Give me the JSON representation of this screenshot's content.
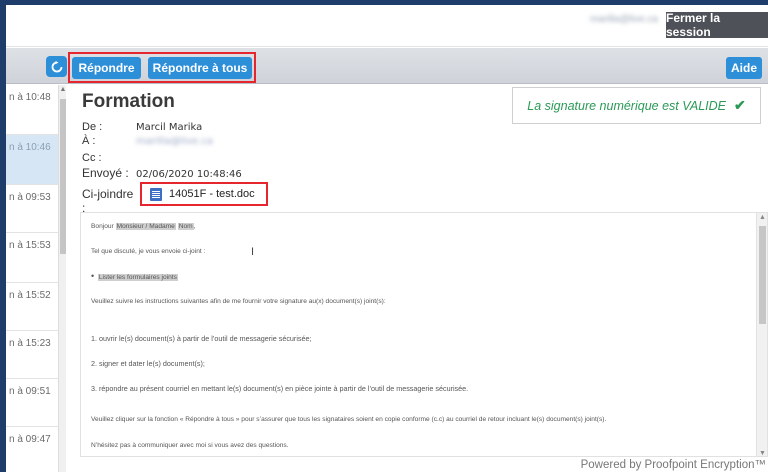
{
  "header": {
    "user_email": "marilla@live.ca",
    "logout_label": "Fermer la session"
  },
  "toolbar": {
    "reply_label": "Répondre",
    "reply_all_label": "Répondre à tous",
    "help_label": "Aide",
    "refresh_icon": "refresh-icon"
  },
  "message_list": {
    "items": [
      {
        "time": "n à 10:48"
      },
      {
        "time": "n à 10:46"
      },
      {
        "time": "n à 09:53"
      },
      {
        "time": "n à 15:53"
      },
      {
        "time": "n à 15:52"
      },
      {
        "time": "n à 15:23"
      },
      {
        "time": "n à 09:51"
      },
      {
        "time": "n à 09:47"
      }
    ]
  },
  "message": {
    "subject": "Formation",
    "from_label": "De :",
    "from_value": "Marcil Marika",
    "to_label": "À :",
    "to_value": "marilla@live.ca",
    "cc_label": "Cc :",
    "sent_label": "Envoyé :",
    "sent_value": "02/06/2020 10:48:46",
    "attach_label": "Ci-joindre :",
    "attachment_name": "14051F - test.doc"
  },
  "signature": {
    "text": "La signature numérique est VALIDE",
    "check": "✔",
    "color": "#2b9a57"
  },
  "body": {
    "greeting_prefix": "Bonjour",
    "greeting_placeholder": "Monsieur / Madame",
    "greeting_name": "Nom",
    "greeting_suffix": ",",
    "intro": "Tel que discuté, je vous envoie ci-joint :",
    "bullet": "Lister les formulaires joints",
    "instructions": "Veuillez suivre les instructions suivantes afin de me fournir votre signature au(x) document(s) joint(s):",
    "step1": "1.  ouvrir le(s) document(s) à partir de l’outil de messagerie sécurisée;",
    "step2": "2.  signer et dater le(s) document(s);",
    "step3": "3.  répondre au présent courriel en mettant le(s) document(s) en pièce jointe à partir de l’outil de messagerie sécurisée.",
    "reply_note": "Veuillez cliquer sur la fonction « Répondre à tous » pour s’assurer que tous les signataires soient en copie conforme (c.c) au courriel de retour incluant le(s) document(s) joint(s).",
    "closing": "N’hésitez pas à communiquer avec moi si vous avez des questions."
  },
  "footer": {
    "powered_by": "Powered by Proofpoint Encryption™"
  },
  "colors": {
    "accent": "#2e8fd9",
    "highlight_border": "#e5262e",
    "logout_bg": "#4e5157"
  }
}
